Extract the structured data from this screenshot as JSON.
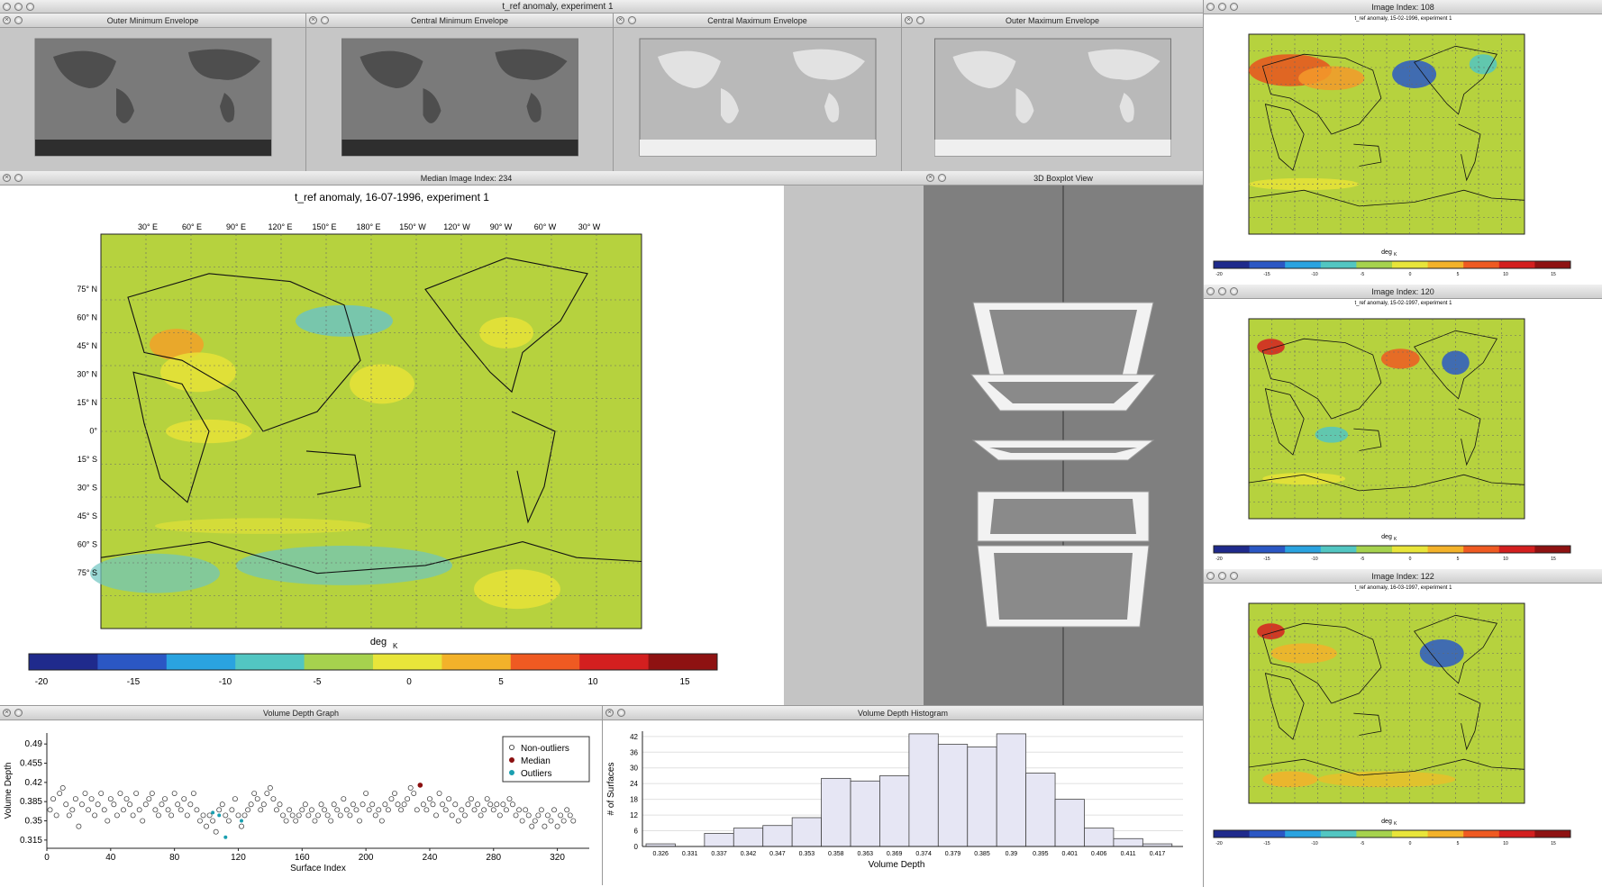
{
  "main_window": {
    "title": "t_ref anomaly, experiment 1"
  },
  "envelopes": [
    {
      "title": "Outer Minimum Envelope"
    },
    {
      "title": "Central Minimum Envelope"
    },
    {
      "title": "Central Maximum Envelope"
    },
    {
      "title": "Outer Maximum Envelope"
    }
  ],
  "median": {
    "window_title": "Median Image Index: 234",
    "map_title": "t_ref anomaly, 16-07-1996, experiment 1",
    "lon_labels": [
      "30° E",
      "60° E",
      "90° E",
      "120° E",
      "150° E",
      "180° E",
      "150° W",
      "120° W",
      "90° W",
      "60° W",
      "30° W"
    ],
    "lat_labels": [
      "75° N",
      "60° N",
      "45° N",
      "30° N",
      "15° N",
      "0°",
      "15° S",
      "30° S",
      "45° S",
      "60° S",
      "75° S"
    ],
    "colorbar_unit": "deg",
    "colorbar_unit_sub": "K",
    "colorbar_ticks": [
      "-20",
      "-15",
      "-10",
      "-5",
      "0",
      "5",
      "10",
      "15"
    ]
  },
  "boxplot": {
    "window_title": "3D Boxplot View"
  },
  "side_windows": [
    {
      "title": "Image Index: 108",
      "map_title": "t_ref anomaly, 15-02-1996, experiment 1"
    },
    {
      "title": "Image Index: 120",
      "map_title": "t_ref anomaly, 15-02-1997, experiment 1"
    },
    {
      "title": "Image Index: 122",
      "map_title": "t_ref anomaly, 16-03-1997, experiment 1"
    }
  ],
  "side_colorbar_ticks": [
    "-20",
    "-15",
    "-10",
    "-5",
    "0",
    "5",
    "10",
    "15"
  ],
  "side_unit": "deg",
  "side_unit_sub": "K",
  "depth_graph": {
    "window_title": "Volume Depth Graph",
    "xlabel": "Surface Index",
    "ylabel": "Volume Depth",
    "legend": [
      "Non-outliers",
      "Median",
      "Outliers"
    ]
  },
  "histogram": {
    "window_title": "Volume Depth Histogram",
    "xlabel": "Volume Depth",
    "ylabel": "# of Surfaces"
  },
  "chart_data": [
    {
      "type": "scatter",
      "xlabel": "Surface Index",
      "ylabel": "Volume Depth",
      "xlim": [
        0,
        340
      ],
      "ylim": [
        0.3,
        0.51
      ],
      "x_ticks": [
        0,
        40,
        80,
        120,
        160,
        200,
        240,
        280,
        320
      ],
      "y_ticks": [
        0.315,
        0.35,
        0.385,
        0.42,
        0.455,
        0.49
      ],
      "series": [
        {
          "name": "Non-outliers",
          "x": [
            2,
            4,
            6,
            8,
            10,
            12,
            14,
            16,
            18,
            20,
            22,
            24,
            26,
            28,
            30,
            32,
            34,
            36,
            38,
            40,
            42,
            44,
            46,
            48,
            50,
            52,
            54,
            56,
            58,
            60,
            62,
            64,
            66,
            68,
            70,
            72,
            74,
            76,
            78,
            80,
            82,
            84,
            86,
            88,
            90,
            92,
            94,
            96,
            98,
            100,
            102,
            104,
            106,
            108,
            110,
            112,
            114,
            116,
            118,
            120,
            122,
            124,
            126,
            128,
            130,
            132,
            134,
            136,
            138,
            140,
            142,
            144,
            146,
            148,
            150,
            152,
            154,
            156,
            158,
            160,
            162,
            164,
            166,
            168,
            170,
            172,
            174,
            176,
            178,
            180,
            182,
            184,
            186,
            188,
            190,
            192,
            194,
            196,
            198,
            200,
            202,
            204,
            206,
            208,
            210,
            212,
            214,
            216,
            218,
            220,
            222,
            224,
            226,
            228,
            230,
            232,
            236,
            238,
            240,
            242,
            244,
            246,
            248,
            250,
            252,
            254,
            256,
            258,
            260,
            262,
            264,
            266,
            268,
            270,
            272,
            274,
            276,
            278,
            280,
            282,
            284,
            286,
            288,
            290,
            292,
            294,
            296,
            298,
            300,
            302,
            304,
            306,
            308,
            310,
            312,
            314,
            316,
            318,
            320,
            322,
            324,
            326,
            328,
            330
          ],
          "y": [
            0.37,
            0.39,
            0.36,
            0.4,
            0.41,
            0.38,
            0.36,
            0.37,
            0.39,
            0.34,
            0.38,
            0.4,
            0.37,
            0.39,
            0.36,
            0.38,
            0.4,
            0.37,
            0.35,
            0.39,
            0.38,
            0.36,
            0.4,
            0.37,
            0.39,
            0.38,
            0.36,
            0.4,
            0.37,
            0.35,
            0.38,
            0.39,
            0.4,
            0.37,
            0.36,
            0.38,
            0.39,
            0.37,
            0.36,
            0.4,
            0.38,
            0.37,
            0.39,
            0.36,
            0.38,
            0.4,
            0.37,
            0.35,
            0.36,
            0.34,
            0.36,
            0.35,
            0.33,
            0.37,
            0.38,
            0.36,
            0.35,
            0.37,
            0.39,
            0.36,
            0.34,
            0.36,
            0.37,
            0.38,
            0.4,
            0.39,
            0.37,
            0.38,
            0.4,
            0.41,
            0.39,
            0.37,
            0.38,
            0.36,
            0.35,
            0.37,
            0.36,
            0.35,
            0.36,
            0.37,
            0.38,
            0.36,
            0.37,
            0.35,
            0.36,
            0.38,
            0.37,
            0.36,
            0.35,
            0.38,
            0.37,
            0.36,
            0.39,
            0.37,
            0.36,
            0.38,
            0.37,
            0.35,
            0.38,
            0.4,
            0.37,
            0.38,
            0.36,
            0.37,
            0.35,
            0.38,
            0.37,
            0.39,
            0.4,
            0.38,
            0.37,
            0.38,
            0.39,
            0.41,
            0.4,
            0.37,
            0.38,
            0.37,
            0.39,
            0.38,
            0.36,
            0.4,
            0.38,
            0.37,
            0.39,
            0.36,
            0.38,
            0.35,
            0.37,
            0.36,
            0.38,
            0.39,
            0.37,
            0.38,
            0.36,
            0.37,
            0.39,
            0.38,
            0.37,
            0.38,
            0.36,
            0.38,
            0.37,
            0.39,
            0.38,
            0.36,
            0.37,
            0.35,
            0.37,
            0.36,
            0.34,
            0.35,
            0.36,
            0.37,
            0.34,
            0.36,
            0.35,
            0.37,
            0.34,
            0.36,
            0.35,
            0.37,
            0.36,
            0.35
          ]
        },
        {
          "name": "Median",
          "x": [
            234
          ],
          "y": [
            0.415
          ]
        },
        {
          "name": "Outliers",
          "x": [
            104,
            108,
            112,
            122
          ],
          "y": [
            0.365,
            0.36,
            0.32,
            0.35
          ]
        }
      ]
    },
    {
      "type": "bar",
      "xlabel": "Volume Depth",
      "ylabel": "# of Surfaces",
      "categories": [
        "0.326",
        "0.331",
        "0.337",
        "0.342",
        "0.347",
        "0.353",
        "0.358",
        "0.363",
        "0.369",
        "0.374",
        "0.379",
        "0.385",
        "0.39",
        "0.395",
        "0.401",
        "0.406",
        "0.411",
        "0.417"
      ],
      "values": [
        1,
        0,
        5,
        7,
        8,
        11,
        26,
        25,
        27,
        43,
        39,
        38,
        43,
        28,
        18,
        7,
        3,
        1
      ],
      "ylim": [
        0,
        44
      ],
      "y_ticks": [
        0,
        6,
        12,
        18,
        24,
        30,
        36,
        42
      ]
    }
  ]
}
